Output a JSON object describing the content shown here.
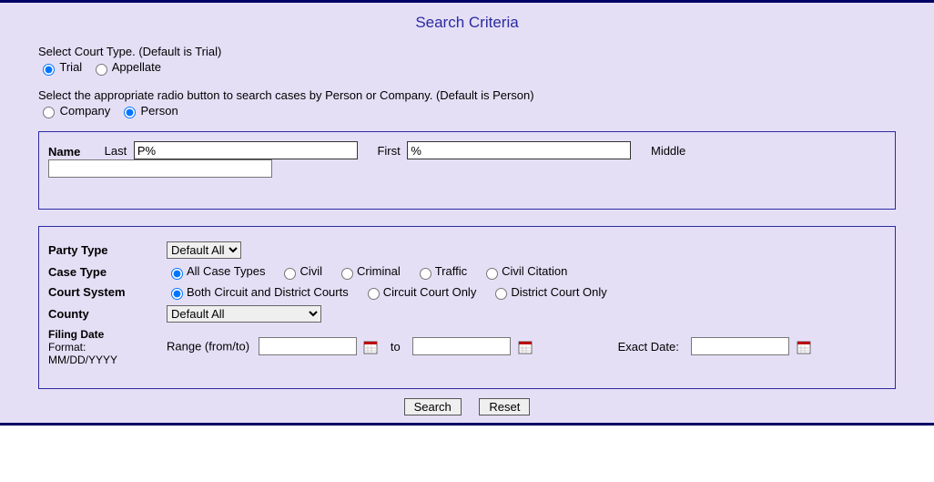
{
  "title": "Search Criteria",
  "courtType": {
    "intro": "Select Court Type. (Default is Trial)",
    "options": {
      "trial": "Trial",
      "appellate": "Appellate"
    }
  },
  "partyKind": {
    "intro": "Select the appropriate radio button to search cases by Person or Company. (Default is Person)",
    "options": {
      "company": "Company",
      "person": "Person"
    }
  },
  "name": {
    "label": "Name",
    "last_label": "Last",
    "last_value": "P%",
    "first_label": "First",
    "first_value": "%",
    "middle_label": "Middle",
    "middle_value": ""
  },
  "partyType": {
    "label": "Party Type",
    "selected": "Default All"
  },
  "caseType": {
    "label": "Case Type",
    "options": {
      "all": "All Case Types",
      "civil": "Civil",
      "criminal": "Criminal",
      "traffic": "Traffic",
      "civcit": "Civil Citation"
    }
  },
  "courtSystem": {
    "label": "Court System",
    "options": {
      "both": "Both Circuit and District Courts",
      "circuit": "Circuit Court Only",
      "district": "District Court Only"
    }
  },
  "county": {
    "label": "County",
    "selected": "Default All"
  },
  "filingDate": {
    "label": "Filing Date",
    "format_label": "Format:",
    "format_hint": "MM/DD/YYYY",
    "range_label": "Range (from/to)",
    "to_label": "to",
    "exact_label": "Exact Date:",
    "from_value": "",
    "to_value": "",
    "exact_value": ""
  },
  "buttons": {
    "search": "Search",
    "reset": "Reset"
  }
}
